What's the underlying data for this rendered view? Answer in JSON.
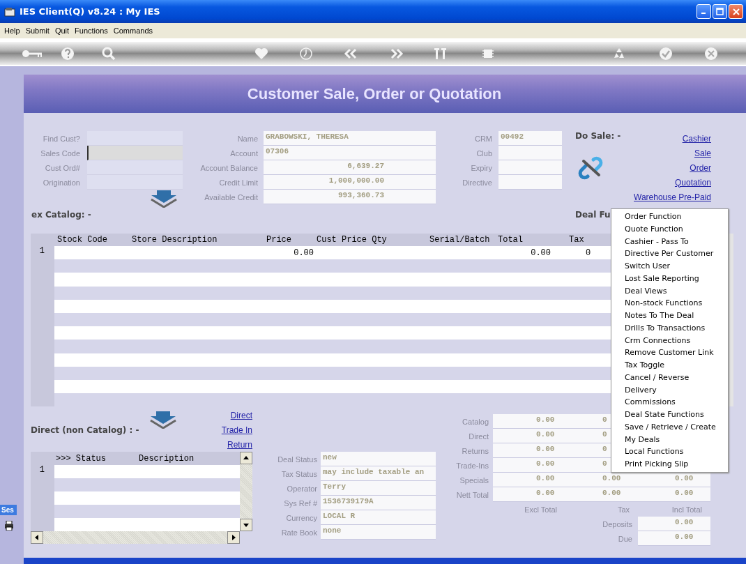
{
  "window": {
    "title": "IES Client(Q) v8.24 : My IES"
  },
  "menu_bar": [
    "Help",
    "Submit",
    "Quit",
    "Functions",
    "Commands"
  ],
  "header": {
    "title": "Customer Sale, Order or Quotation"
  },
  "customer_lookup": [
    {
      "label": "Find Cust?",
      "focused": false
    },
    {
      "label": "Sales Code",
      "focused": true
    },
    {
      "label": "Cust Ord#",
      "focused": false
    },
    {
      "label": "Origination",
      "focused": false
    }
  ],
  "customer": [
    {
      "label": "Name",
      "value": "GRABOWSKI, THERESA",
      "kind": "text"
    },
    {
      "label": "Account",
      "value": "07306",
      "kind": "text"
    },
    {
      "label": "Account Balance",
      "value": "6,639.27",
      "kind": "amount"
    },
    {
      "label": "Credit Limit",
      "value": "1,000,000.00",
      "kind": "amount"
    },
    {
      "label": "Available Credit",
      "value": "993,360.73",
      "kind": "amount"
    }
  ],
  "crm": [
    {
      "label": "CRM",
      "value": "00492"
    },
    {
      "label": "Club"
    },
    {
      "label": "Expiry"
    },
    {
      "label": "Directive"
    }
  ],
  "do_sale": {
    "title": "Do Sale: -",
    "links": [
      "Cashier",
      "Sale",
      "Order",
      "Quotation",
      "Warehouse Pre-Paid"
    ]
  },
  "catalog": {
    "title": "ex Catalog: -"
  },
  "deal_functions": {
    "title": "Deal Fu"
  },
  "catalog_grid": {
    "columns": [
      "Stock Code",
      "Store Description",
      "Price",
      "Cust Price Qty",
      "Serial/Batch",
      "Total",
      "Tax"
    ],
    "rows": [
      {
        "number": "1",
        "price": "0.00",
        "total": "0.00",
        "tax": "0"
      }
    ]
  },
  "direct": {
    "title": "Direct (non Catalog) : -",
    "links": [
      "Direct",
      "Trade In",
      "Return"
    ]
  },
  "direct_grid": {
    "columns": [
      ">>> Status",
      "Description"
    ],
    "rows": [
      {
        "number": "1"
      }
    ]
  },
  "deal_info": [
    {
      "label": "Deal Status",
      "value": "new"
    },
    {
      "label": "Tax Status",
      "value": "may include taxable an"
    },
    {
      "label": "Operator",
      "value": "Terry"
    },
    {
      "label": "Sys Ref #",
      "value": "1536739179A"
    },
    {
      "label": "Currency",
      "value": "LOCAL R"
    },
    {
      "label": "Rate Book",
      "value": "none"
    }
  ],
  "totals": {
    "rows": [
      {
        "label": "Catalog",
        "values": [
          "0.00",
          "0"
        ]
      },
      {
        "label": "Direct",
        "values": [
          "0.00",
          "0"
        ]
      },
      {
        "label": "Returns",
        "values": [
          "0.00",
          "0"
        ]
      },
      {
        "label": "Trade-Ins",
        "values": [
          "0.00",
          "0"
        ]
      },
      {
        "label": "Specials",
        "values": [
          "0.00",
          "0.00",
          "0.00"
        ]
      },
      {
        "label": "Nett Total",
        "values": [
          "0.00",
          "0.00",
          "0.00"
        ]
      }
    ],
    "footer": [
      "Excl Total",
      "Tax",
      "Incl Total"
    ],
    "balance": [
      {
        "label": "Deposits",
        "value": "0.00"
      },
      {
        "label": "Due",
        "value": "0.00"
      }
    ]
  },
  "side_tab": {
    "label": "Ses"
  },
  "popup_menu": [
    "Order Function",
    "Quote Function",
    "Cashier - Pass To",
    "Directive Per Customer",
    "Switch User",
    "Lost Sale Reporting",
    "Deal Views",
    "Non-stock Functions",
    "Notes To The Deal",
    "Drills To Transactions",
    "Crm Connections",
    "Remove Customer Link",
    "Tax Toggle",
    "Cancel / Reverse",
    "Delivery",
    "Commissions",
    "Deal State Functions",
    "Save / Retrieve / Create",
    "My Deals",
    "Local Functions",
    "Print Picking Slip"
  ]
}
